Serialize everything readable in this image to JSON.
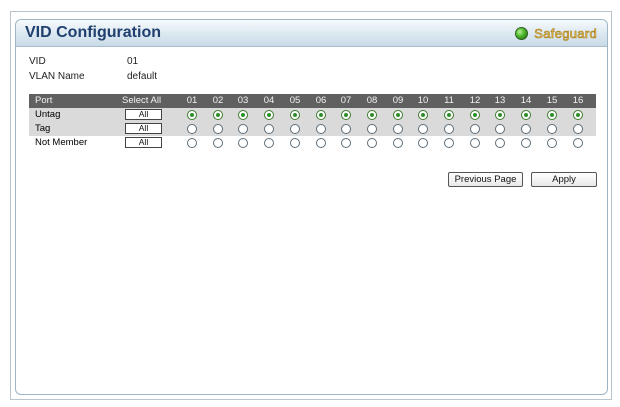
{
  "panel": {
    "title": "VID Configuration",
    "safeguard_label": "Safeguard",
    "safeguard_icon": "status-led-icon"
  },
  "info": {
    "vid_label": "VID",
    "vid_value": "01",
    "vlan_name_label": "VLAN Name",
    "vlan_name_value": "default"
  },
  "table": {
    "port_header": "Port",
    "select_all_header": "Select All",
    "ports": [
      "01",
      "02",
      "03",
      "04",
      "05",
      "06",
      "07",
      "08",
      "09",
      "10",
      "11",
      "12",
      "13",
      "14",
      "15",
      "16"
    ],
    "rows": [
      {
        "label": "Untag",
        "button": "All",
        "selected": true
      },
      {
        "label": "Tag",
        "button": "All",
        "selected": false
      },
      {
        "label": "Not Member",
        "button": "All",
        "selected": false
      }
    ]
  },
  "buttons": {
    "previous_page": "Previous Page",
    "apply": "Apply"
  },
  "colors": {
    "title_text": "#1f3f6e",
    "header_row": "#606060",
    "alt_row": "#dadada",
    "radio_selected": "#2f8f2a"
  }
}
